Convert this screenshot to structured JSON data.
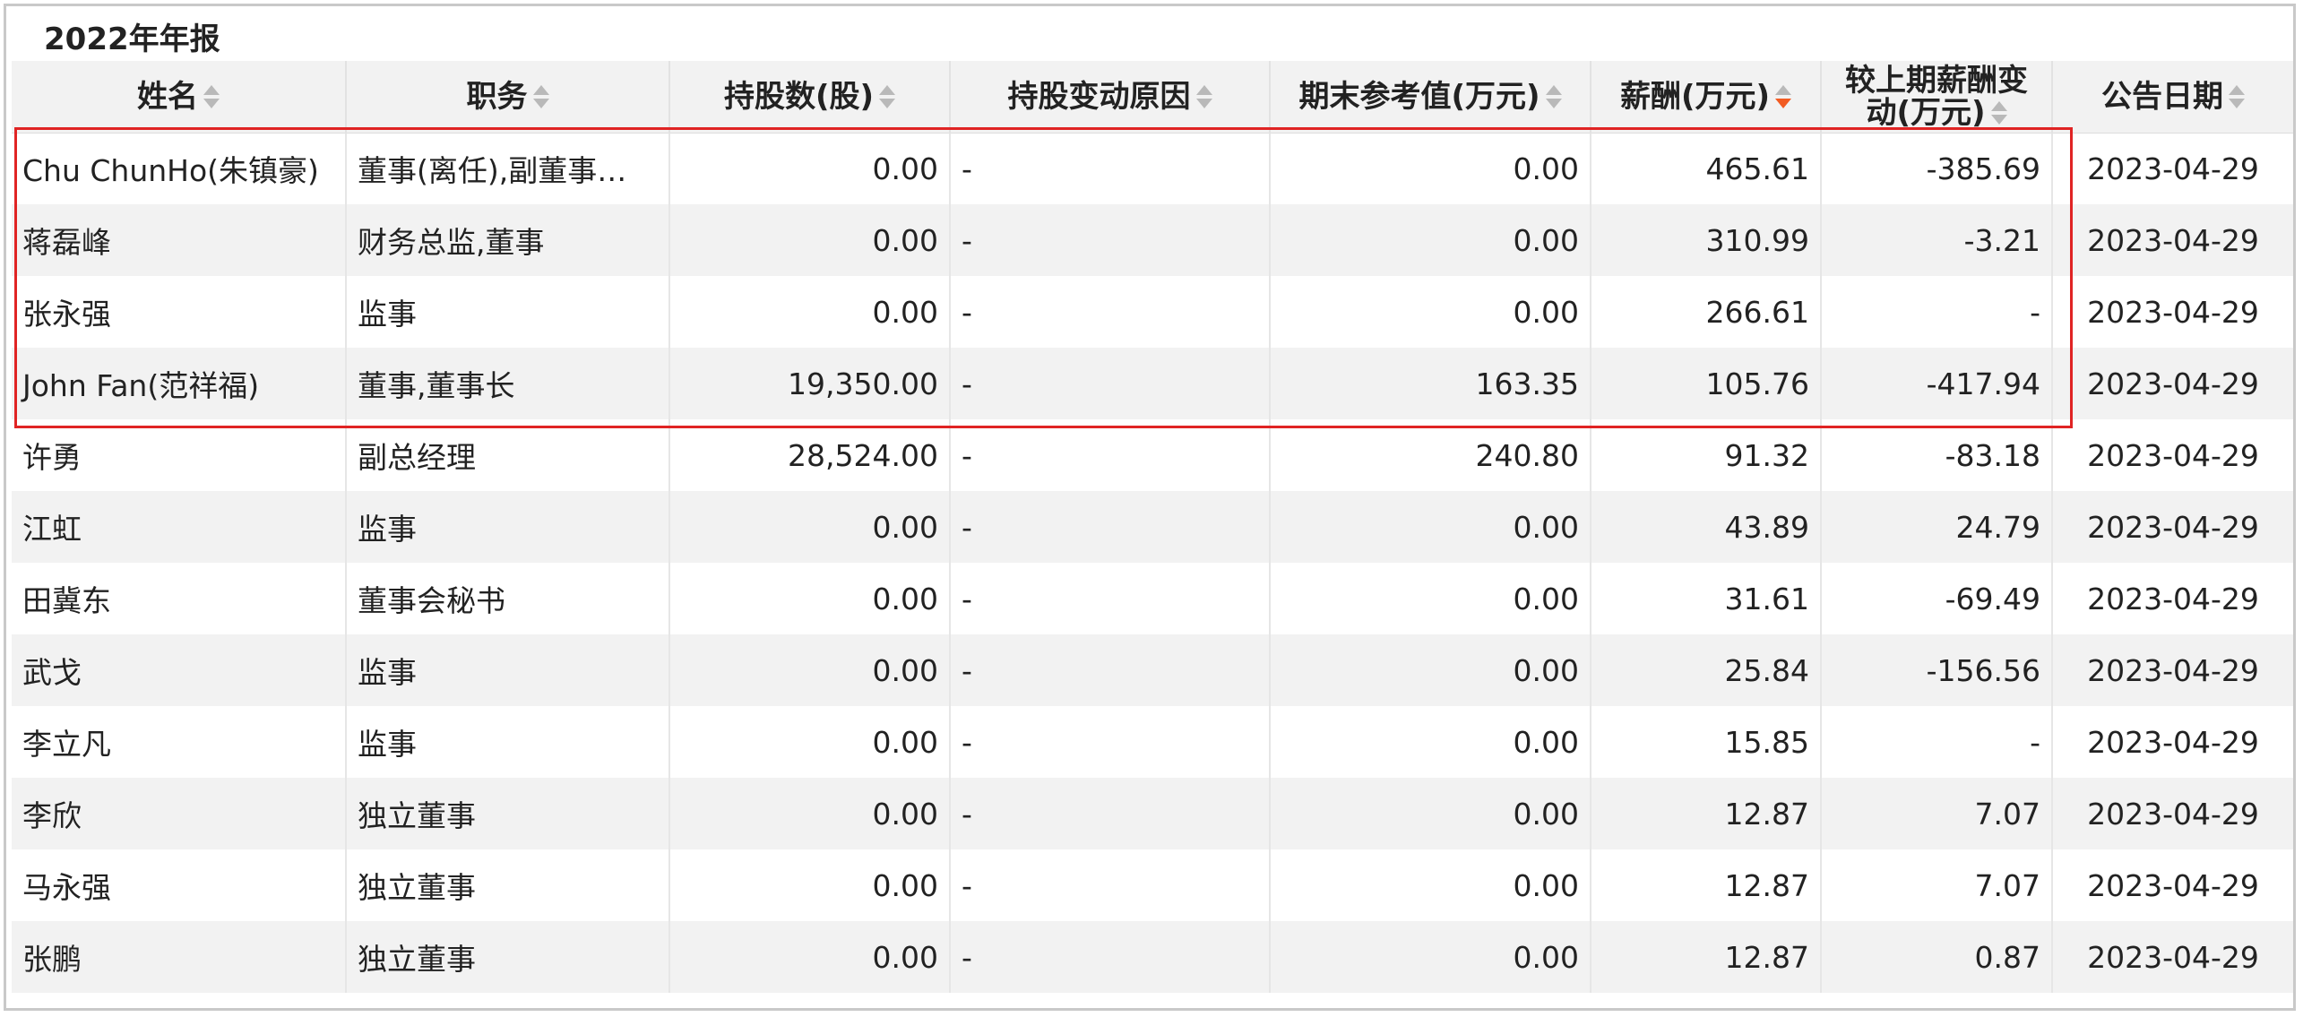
{
  "report_title": "2022年年报",
  "highlight_color": "#e02424",
  "sort_active_color": "#f25b22",
  "columns": [
    {
      "label": "姓名",
      "sort": "none"
    },
    {
      "label": "职务",
      "sort": "none"
    },
    {
      "label": "持股数(股)",
      "sort": "none"
    },
    {
      "label": "持股变动原因",
      "sort": "none"
    },
    {
      "label": "期末参考值(万元)",
      "sort": "none"
    },
    {
      "label": "薪酬(万元)",
      "sort": "desc"
    },
    {
      "label": "较上期薪酬变动(万元)",
      "sort": "none"
    },
    {
      "label": "公告日期",
      "sort": "none"
    }
  ],
  "rows": [
    {
      "name": "Chu ChunHo(朱镇豪)",
      "position": "董事(离任),副董事…",
      "shares": "0.00",
      "reason": "-",
      "ref_value": "0.00",
      "salary": "465.61",
      "change": "-385.69",
      "date": "2023-04-29"
    },
    {
      "name": "蒋磊峰",
      "position": "财务总监,董事",
      "shares": "0.00",
      "reason": "-",
      "ref_value": "0.00",
      "salary": "310.99",
      "change": "-3.21",
      "date": "2023-04-29"
    },
    {
      "name": "张永强",
      "position": "监事",
      "shares": "0.00",
      "reason": "-",
      "ref_value": "0.00",
      "salary": "266.61",
      "change": "-",
      "date": "2023-04-29"
    },
    {
      "name": "John Fan(范祥福)",
      "position": "董事,董事长",
      "shares": "19,350.00",
      "reason": "-",
      "ref_value": "163.35",
      "salary": "105.76",
      "change": "-417.94",
      "date": "2023-04-29"
    },
    {
      "name": "许勇",
      "position": "副总经理",
      "shares": "28,524.00",
      "reason": "-",
      "ref_value": "240.80",
      "salary": "91.32",
      "change": "-83.18",
      "date": "2023-04-29"
    },
    {
      "name": "江虹",
      "position": "监事",
      "shares": "0.00",
      "reason": "-",
      "ref_value": "0.00",
      "salary": "43.89",
      "change": "24.79",
      "date": "2023-04-29"
    },
    {
      "name": "田冀东",
      "position": "董事会秘书",
      "shares": "0.00",
      "reason": "-",
      "ref_value": "0.00",
      "salary": "31.61",
      "change": "-69.49",
      "date": "2023-04-29"
    },
    {
      "name": "武戈",
      "position": "监事",
      "shares": "0.00",
      "reason": "-",
      "ref_value": "0.00",
      "salary": "25.84",
      "change": "-156.56",
      "date": "2023-04-29"
    },
    {
      "name": "李立凡",
      "position": "监事",
      "shares": "0.00",
      "reason": "-",
      "ref_value": "0.00",
      "salary": "15.85",
      "change": "-",
      "date": "2023-04-29"
    },
    {
      "name": "李欣",
      "position": "独立董事",
      "shares": "0.00",
      "reason": "-",
      "ref_value": "0.00",
      "salary": "12.87",
      "change": "7.07",
      "date": "2023-04-29"
    },
    {
      "name": "马永强",
      "position": "独立董事",
      "shares": "0.00",
      "reason": "-",
      "ref_value": "0.00",
      "salary": "12.87",
      "change": "7.07",
      "date": "2023-04-29"
    },
    {
      "name": "张鹏",
      "position": "独立董事",
      "shares": "0.00",
      "reason": "-",
      "ref_value": "0.00",
      "salary": "12.87",
      "change": "0.87",
      "date": "2023-04-29"
    }
  ]
}
